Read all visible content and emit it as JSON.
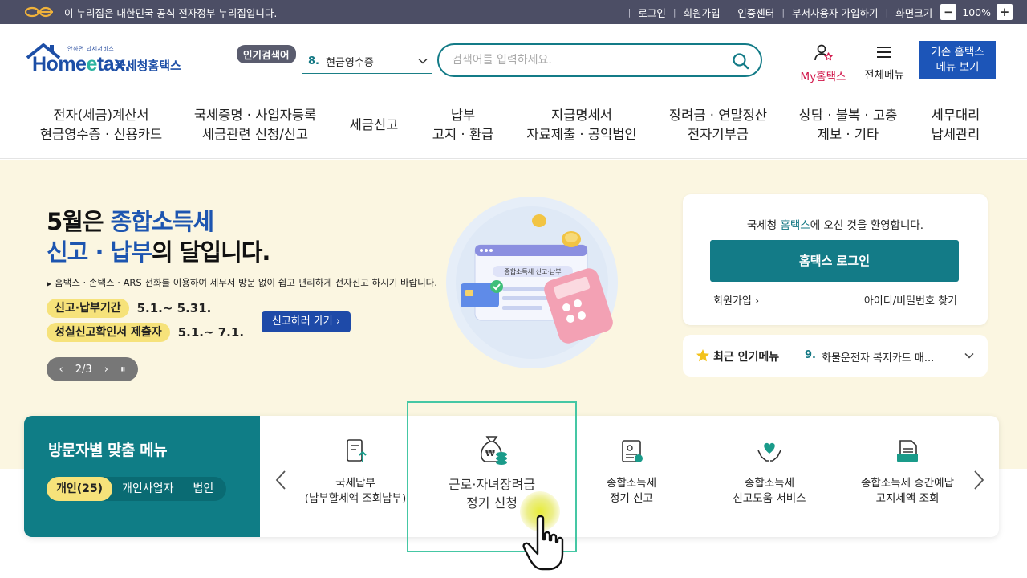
{
  "govbar": {
    "notice": "이 누리집은 대한민국 공식 전자정부 누리집입니다.",
    "links": [
      "로그인",
      "회원가입",
      "인증센터",
      "부서사용자 가입하기",
      "화면크기"
    ],
    "zoom_minus": "−",
    "zoom_value": "100%",
    "zoom_plus": "+"
  },
  "header": {
    "logo_small": "안하면 납세서비스",
    "logo_home": "Home",
    "logo_e": "e",
    "logo_tax": "tax.",
    "logo_kor": "국세청홈택스",
    "popular_badge": "인기검색어",
    "popular_num": "8.",
    "popular_term": "현금영수증",
    "search_placeholder": "검색어를 입력하세요.",
    "my_label": "My홈택스",
    "all_menu_label": "전체메뉴",
    "old_menu_line1": "기존 홈택스",
    "old_menu_line2": "메뉴 보기"
  },
  "nav": [
    {
      "line1": "전자(세금)계산서",
      "line2": "현금영수증 · 신용카드"
    },
    {
      "line1": "국세증명 · 사업자등록",
      "line2": "세금관련 신청/신고"
    },
    {
      "line1": "세금신고",
      "line2": ""
    },
    {
      "line1": "납부",
      "line2": "고지 · 환급"
    },
    {
      "line1": "지급명세서",
      "line2": "자료제출 · 공익법인"
    },
    {
      "line1": "장려금 · 연말정산",
      "line2": "전자기부금"
    },
    {
      "line1": "상담 · 불복 · 고충",
      "line2": "제보 · 기타"
    },
    {
      "line1": "세무대리",
      "line2": "납세관리"
    }
  ],
  "hero": {
    "title_a": "5월은 ",
    "title_b": "종합소득세",
    "title_c": "신고 · 납부",
    "title_d": "의 달입니다.",
    "desc": "홈택스 · 손택스 · ARS 전화를 이용하여 세무서 방문 없이 쉽고 편리하게 전자신고 하시기 바랍니다.",
    "period1_tag": "신고·납부기간",
    "period1_val": "5.1.~ 5.31.",
    "period2_tag": "성실신고확인서 제출자",
    "period2_val": "5.1.~ 7.1.",
    "goto_label": "신고하러 가기",
    "pager_prev": "‹",
    "pager_text": "2/3",
    "pager_next": "›",
    "pager_pause": "⏸",
    "illu_label": "종합소득세 신고·납부"
  },
  "login": {
    "welcome_a": "국세청 ",
    "welcome_b": "홈택스",
    "welcome_c": "에 오신 것을 환영합니다.",
    "button": "홈택스 로그인",
    "join": "회원가입",
    "find": "아이디/비밀번호 찾기"
  },
  "recent": {
    "title": "최근 인기메뉴",
    "num": "9.",
    "item": "화물운전자 복지카드 매..."
  },
  "visitor": {
    "title": "방문자별 맞춤 메뉴",
    "tabs": [
      "개인(25)",
      "개인사업자",
      "법인"
    ],
    "services": [
      {
        "line1": "국세납부",
        "line2": "(납부할세액 조회납부)"
      },
      {
        "line1": "근로·자녀장려금",
        "line2": "정기 신청"
      },
      {
        "line1": "종합소득세",
        "line2": "정기 신고"
      },
      {
        "line1": "종합소득세",
        "line2": "신고도움 서비스"
      },
      {
        "line1": "종합소득세 중간예납",
        "line2": "고지세액 조회"
      }
    ]
  },
  "colors": {
    "teal": "#137b87",
    "navy_bar": "#4c4e65",
    "hero_bg": "#fbf6e1",
    "yellow_tag": "#f6e27a",
    "blue_btn": "#1c55b8",
    "highlight": "#45c7a4"
  },
  "icons": [
    "gov-logo-icon",
    "house-roof-icon",
    "chevron-down-icon",
    "search-icon",
    "user-star-icon",
    "hamburger-icon",
    "star-icon",
    "tax-doc-icon",
    "money-bag-icon",
    "document-icon",
    "hands-heart-icon",
    "folder-doc-icon",
    "pointer-hand-icon"
  ]
}
